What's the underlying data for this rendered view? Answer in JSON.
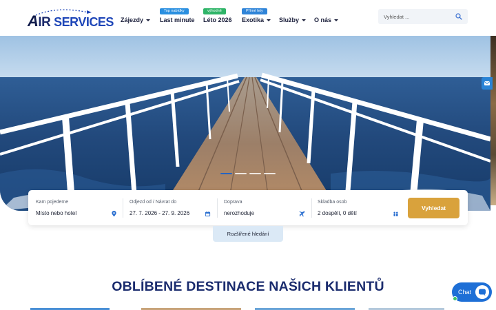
{
  "brand": {
    "logo_first": "A",
    "logo_mid": "IR ",
    "logo_rest": "SERVICES"
  },
  "nav": {
    "items": [
      {
        "label": "Zájezdy",
        "dropdown": true
      },
      {
        "label": "Last minute",
        "badge": "Top nabídky"
      },
      {
        "label": "Léto 2026",
        "badge": "výhodně"
      },
      {
        "label": "Exotika",
        "badge": "Přímé lety",
        "dropdown": true
      },
      {
        "label": "Služby",
        "dropdown": true
      },
      {
        "label": "O nás",
        "dropdown": true
      }
    ]
  },
  "search": {
    "placeholder": "Vyhledat ...",
    "icon": "search-icon"
  },
  "hero": {
    "slides": 4,
    "active_slide": 1
  },
  "booking": {
    "destination": {
      "label": "Kam pojedeme",
      "value": "Místo nebo hotel",
      "icon": "map-pin-icon"
    },
    "dates": {
      "label": "Odjezd od / Návrat do",
      "value": "27. 7. 2026 - 27. 9. 2026",
      "icon": "calendar-icon"
    },
    "transport": {
      "label": "Doprava",
      "value": "nerozhoduje",
      "icon": "plane-icon"
    },
    "people": {
      "label": "Skladba osob",
      "value": "2 dospělí, 0 dětí",
      "icon": "people-icon"
    },
    "submit": "Vyhledat"
  },
  "advanced_search": "Rozšířené hledání",
  "section_title": "OBLÍBENÉ DESTINACE NAŠICH KLIENTŮ",
  "chat": {
    "label": "Chat"
  },
  "colors": {
    "accent": "#d9a23c",
    "primary": "#1b2c6e",
    "badge_blue": "#2a8fe0",
    "badge_green": "#2fb468",
    "chat": "#1e6fd6"
  }
}
